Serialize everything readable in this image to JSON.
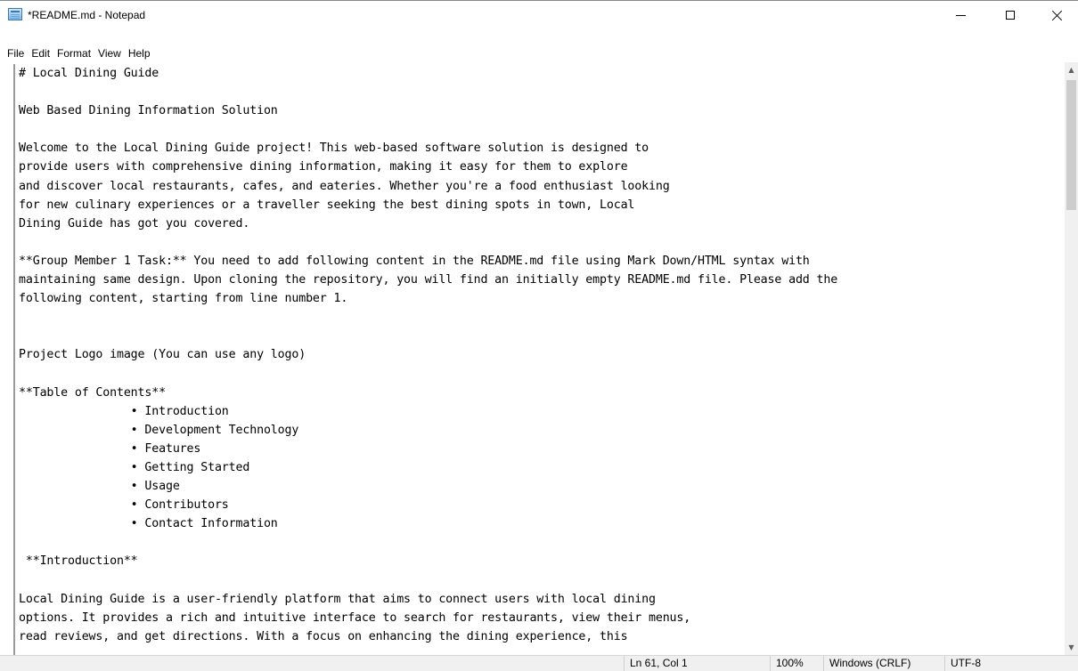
{
  "window": {
    "title": "*README.md - Notepad"
  },
  "menu": {
    "items": [
      "File",
      "Edit",
      "Format",
      "View",
      "Help"
    ]
  },
  "editor": {
    "lines": [
      "# Local Dining Guide",
      "",
      "Web Based Dining Information Solution",
      "",
      "Welcome to the Local Dining Guide project! This web-based software solution is designed to",
      "provide users with comprehensive dining information, making it easy for them to explore",
      "and discover local restaurants, cafes, and eateries. Whether you're a food enthusiast looking",
      "for new culinary experiences or a traveller seeking the best dining spots in town, Local",
      "Dining Guide has got you covered.",
      "",
      "**Group Member 1 Task:** You need to add following content in the README.md file using Mark Down/HTML syntax with",
      "maintaining same design. Upon cloning the repository, you will find an initially empty README.md file. Please add the",
      "following content, starting from line number 1.",
      "",
      "",
      "Project Logo image (You can use any logo)",
      "",
      "**Table of Contents**",
      "                • Introduction",
      "                • Development Technology",
      "                • Features",
      "                • Getting Started",
      "                • Usage",
      "                • Contributors",
      "                • Contact Information",
      "",
      " **Introduction**",
      "",
      "Local Dining Guide is a user-friendly platform that aims to connect users with local dining",
      "options. It provides a rich and intuitive interface to search for restaurants, view their menus,",
      "read reviews, and get directions. With a focus on enhancing the dining experience, this"
    ]
  },
  "statusbar": {
    "position": "Ln 61, Col 1",
    "zoom": "100%",
    "line_ending": "Windows (CRLF)",
    "encoding": "UTF-8"
  },
  "icons": {
    "app": "notepad-icon",
    "minimize": "minimize-icon",
    "maximize": "maximize-icon",
    "close": "close-icon",
    "scroll_up": "chevron-up-icon",
    "scroll_down": "chevron-down-icon"
  }
}
